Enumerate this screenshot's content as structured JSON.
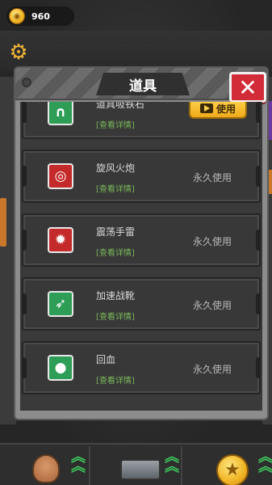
{
  "coins": {
    "value": "960"
  },
  "panel": {
    "title": "道具",
    "close_label": "✕"
  },
  "items": [
    {
      "name": "道具吸铁石",
      "detail": "[查看详情]",
      "status": "",
      "action": "使用",
      "icon": "magnet-icon",
      "icon_glyph": "∩",
      "icon_color": "#2e9e57"
    },
    {
      "name": "旋风火炮",
      "detail": "[查看详情]",
      "status": "永久使用",
      "action": "",
      "icon": "target-icon",
      "icon_glyph": "◎",
      "icon_color": "#c42a2a"
    },
    {
      "name": "震荡手雷",
      "detail": "[查看详情]",
      "status": "永久使用",
      "action": "",
      "icon": "grenade-icon",
      "icon_glyph": "✹",
      "icon_color": "#c42a2a"
    },
    {
      "name": "加速战靴",
      "detail": "[查看详情]",
      "status": "永久使用",
      "action": "",
      "icon": "boot-icon",
      "icon_glyph": "➶",
      "icon_color": "#2e9e57"
    },
    {
      "name": "回血",
      "detail": "[查看详情]",
      "status": "永久使用",
      "action": "",
      "icon": "blood-drop-icon",
      "icon_glyph": "●",
      "icon_color": "#2e9e57"
    }
  ],
  "colors": {
    "accent_gold": "#f0b323",
    "close_red": "#d22c38",
    "detail_green": "#7ab85a"
  }
}
